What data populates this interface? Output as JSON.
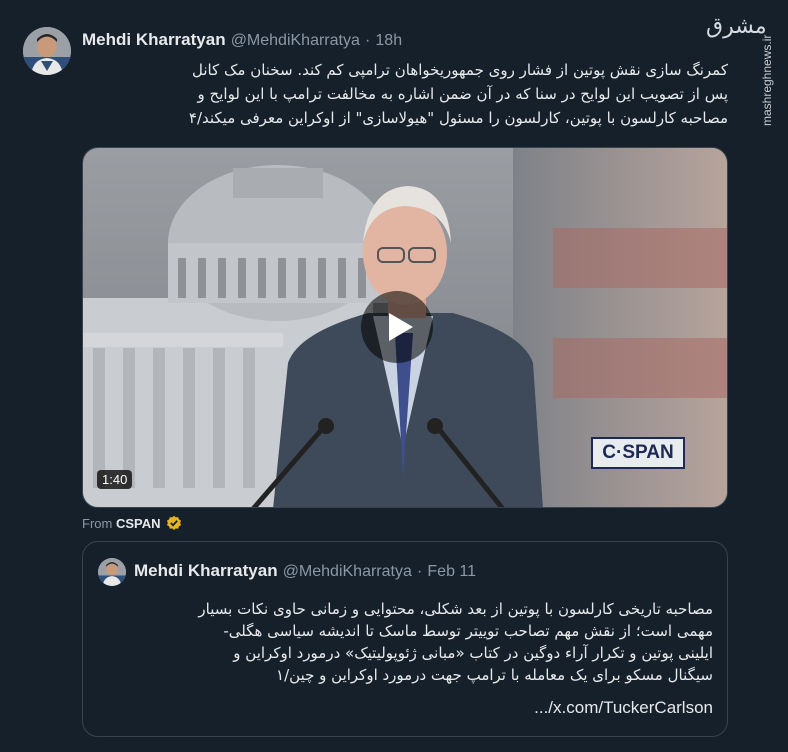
{
  "tweet": {
    "author_name": "Mehdi Kharratyan",
    "author_handle": "@MehdiKharratya",
    "separator": "·",
    "time": "18h",
    "text_lines": [
      "کمرنگ سازی نقش پوتین از فشار روی جمهوریخواهان ترامپی کم کند. سخنان مک کانل",
      "پس از تصویب این لوایح در سنا که در آن ضمن اشاره به مخالفت ترامپ با این لوایح و",
      "مصاحبه کارلسون با پوتین، کارلسون را مسئول \"هیولاسازی\" از اوکراین معرفی میکند/۴"
    ]
  },
  "video": {
    "duration": "1:40",
    "channel_logo": "C·SPAN",
    "play_icon": "play-icon"
  },
  "attribution": {
    "prefix": "From",
    "source": "CSPAN",
    "badge_icon": "verified-gold-icon",
    "badge_color": "#e6b325"
  },
  "quote": {
    "author_name": "Mehdi Kharratyan",
    "author_handle": "@MehdiKharratya",
    "separator": "·",
    "date": "Feb 11",
    "text_lines": [
      "مصاحبه تاریخی کارلسون با پوتین از بعد شکلی، محتوایی و زمانی حاوی نکات بسیار",
      "مهمی است؛ از نقش مهم تصاحب توییتر توسط ماسک تا اندیشه سیاسی هگلی-",
      "ایلینی پوتین و تکرار آراء دوگین در کتاب «مبانی ژئوپولیتیک» درمورد اوکراین و",
      "سیگنال مسکو برای یک معامله با ترامپ جهت درمورد اوکراین و چین/۱"
    ],
    "link": "x.com/TuckerCarlson/..."
  },
  "watermark": {
    "logo": "مشرق",
    "site": "mashreghnews.ir"
  },
  "colors": {
    "background": "#15202b",
    "border": "#38444d",
    "text": "#e7e9ea",
    "secondary": "#8b98a5"
  }
}
